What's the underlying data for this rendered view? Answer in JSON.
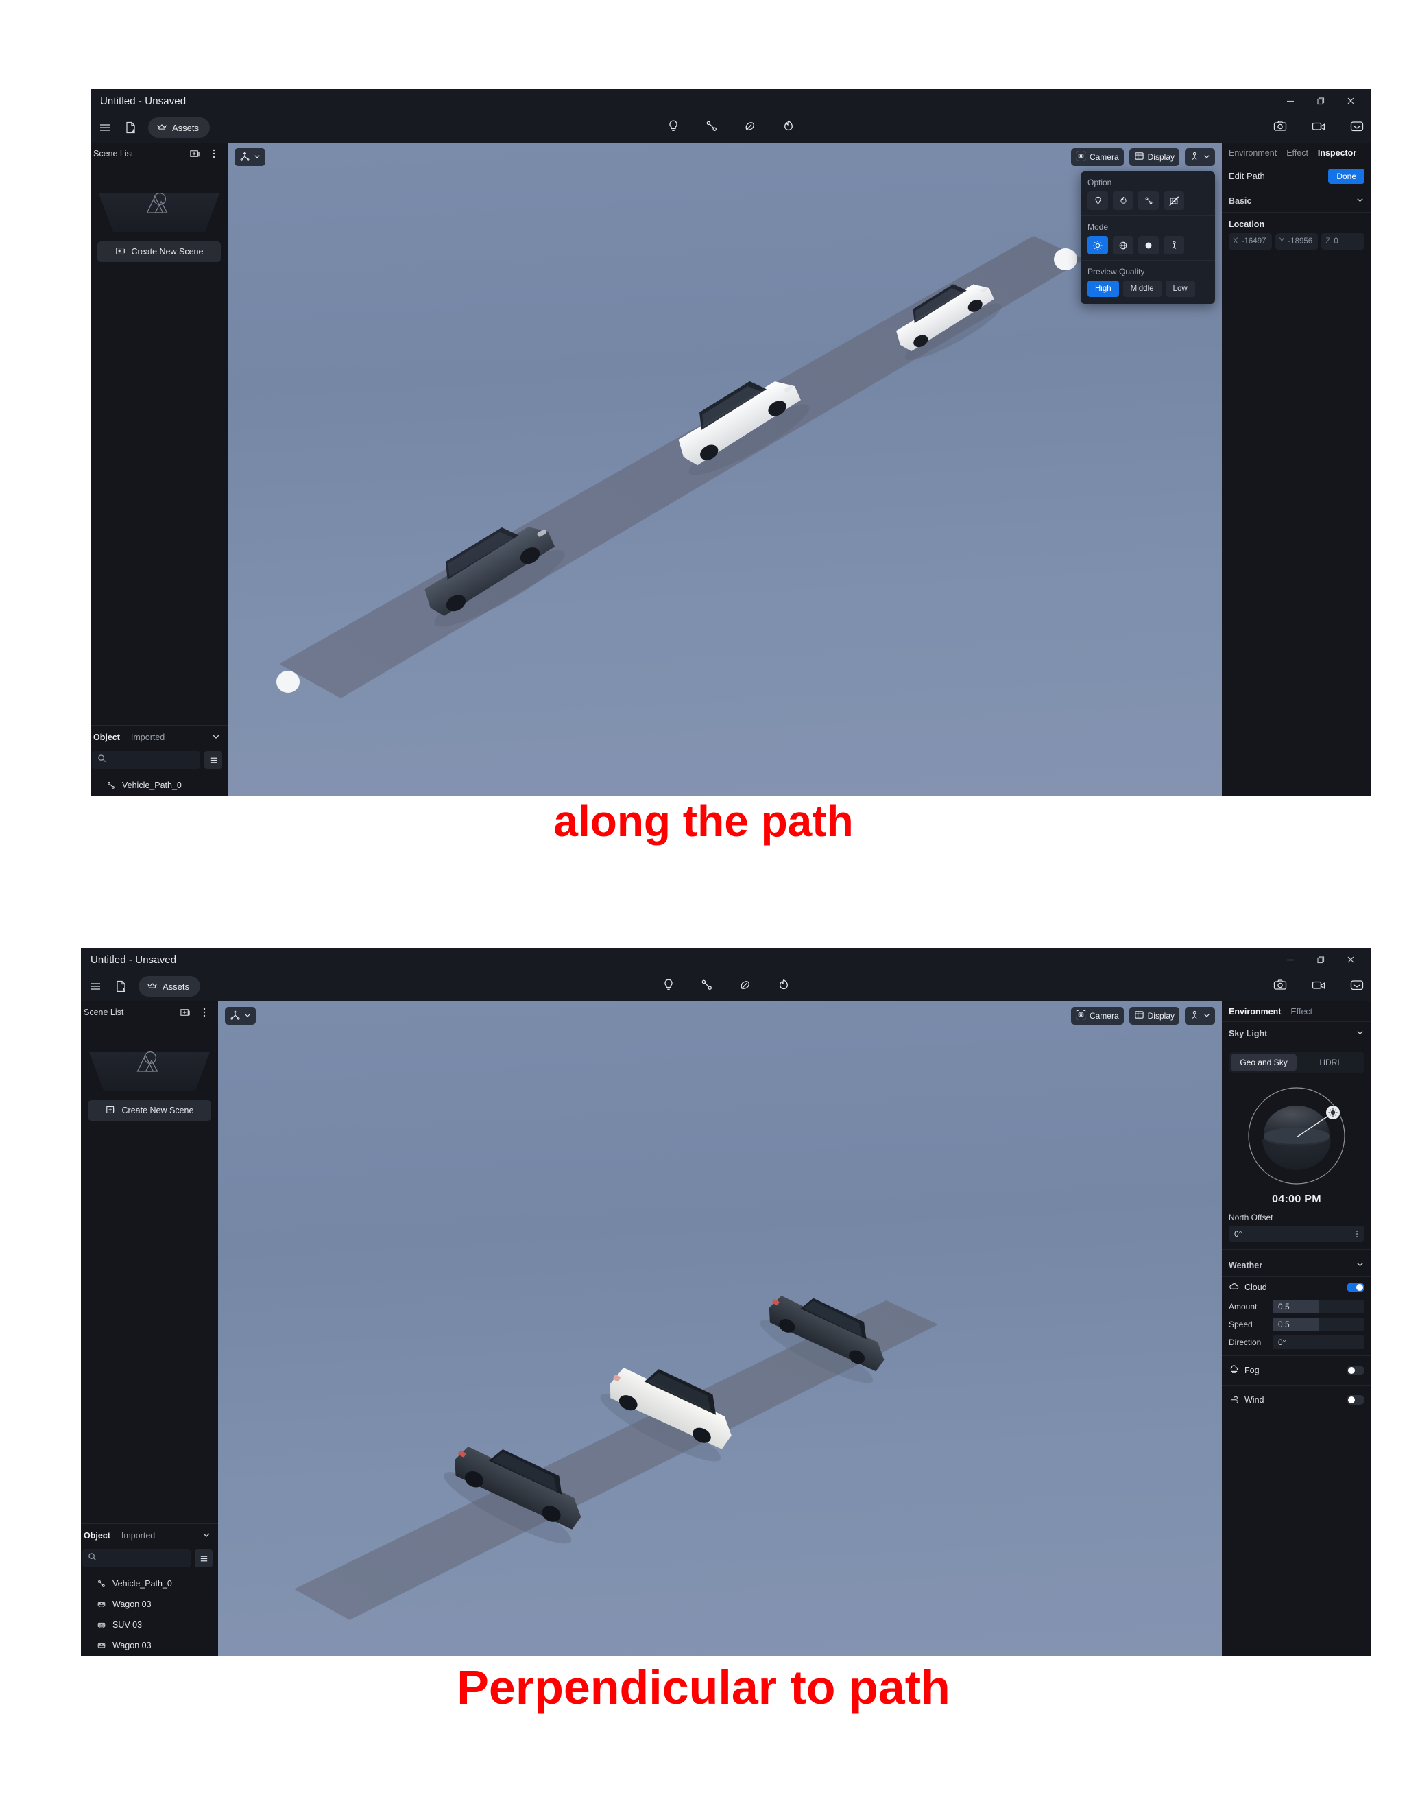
{
  "captions": {
    "top": "along the path",
    "bottom": "Perpendicular to path",
    "color": "#fe0000"
  },
  "window": {
    "title": "Untitled - Unsaved",
    "controls": {
      "minimize": "minimize-icon",
      "maximize": "restore-icon",
      "close": "close-icon"
    }
  },
  "toolbar": {
    "menu_icon": "hamburger-icon",
    "import_icon": "file-import-icon",
    "assets_label": "Assets",
    "assets_icon": "assets-crown-icon",
    "center_icons": [
      "light-bulb-icon",
      "path-node-icon",
      "leaf-icon",
      "fire-icon"
    ],
    "right_icons": [
      "camera-photo-icon",
      "video-camera-icon",
      "export-inbox-icon"
    ]
  },
  "scene_panel": {
    "title": "Scene List",
    "add_icon": "add-scene-icon",
    "more_icon": "more-vertical-icon",
    "placeholder_icon": "mountain-icon",
    "create_button": "Create New Scene",
    "create_icon": "add-frame-icon"
  },
  "object_panel": {
    "tabs": [
      "Object",
      "Imported"
    ],
    "active_tab": "Object",
    "collapse_icon": "chevron-down-icon",
    "search_placeholder": "",
    "search_value": "",
    "search_icon": "search-icon",
    "list_icon": "list-lines-icon",
    "items_top": [
      {
        "label": "Vehicle_Path_0",
        "icon": "path-node-icon"
      }
    ],
    "items_bottom": [
      {
        "label": "Vehicle_Path_0",
        "icon": "path-node-icon"
      },
      {
        "label": "Wagon 03",
        "icon": "car-icon"
      },
      {
        "label": "SUV 03",
        "icon": "car-icon"
      },
      {
        "label": "Wagon 03",
        "icon": "car-icon"
      }
    ]
  },
  "viewport": {
    "gizmo_label": "",
    "gizmo_icon": "axis-gizmo-icon",
    "chevron_icon": "chevron-down-icon",
    "camera_button": "Camera",
    "camera_icon": "camera-frame-icon",
    "display_button": "Display",
    "display_icon": "cube-display-icon",
    "lighting_icon": "lighting-gizmo-icon",
    "sky_color_top": "#7b8cab",
    "sky_color_bottom": "#8493b0",
    "road_color": "#6e768c"
  },
  "option_popup": {
    "option_label": "Option",
    "option_icons": [
      "light-bulb-icon",
      "fire-icon",
      "path-node-icon",
      "grid-icon"
    ],
    "option_active_index": -1,
    "mode_label": "Mode",
    "mode_icons": [
      "sun-icon",
      "globe-wire-icon",
      "sphere-solid-icon",
      "person-icon"
    ],
    "mode_active_index": 0,
    "preview_quality_label": "Preview Quality",
    "quality_options": [
      "High",
      "Middle",
      "Low"
    ],
    "quality_active": "High"
  },
  "inspector": {
    "tabs": [
      "Environment",
      "Effect",
      "Inspector"
    ],
    "active_tab": "Inspector",
    "panel_title": "Edit Path",
    "done_button": "Done",
    "basic_section": "Basic",
    "location_label": "Location",
    "location": {
      "x_axis": "X",
      "x": "-16497",
      "y_axis": "Y",
      "y": "-18956",
      "z_axis": "Z",
      "z": "0"
    }
  },
  "environment": {
    "tabs": [
      "Environment",
      "Effect"
    ],
    "active_tab": "Environment",
    "sky_light_label": "Sky Light",
    "seg_tabs": [
      "Geo and Sky",
      "HDRI"
    ],
    "seg_active": "Geo and Sky",
    "time": "04:00 PM",
    "sun_icon": "sun-handle-icon",
    "north_offset_label": "North Offset",
    "north_offset_value": "0°",
    "weather_label": "Weather",
    "cloud": {
      "label": "Cloud",
      "icon": "cloud-icon",
      "enabled": true,
      "fields": [
        {
          "key": "Amount",
          "value": "0.5",
          "fill_pct": 50
        },
        {
          "key": "Speed",
          "value": "0.5",
          "fill_pct": 50
        },
        {
          "key": "Direction",
          "value": "0°",
          "fill_pct": 0
        }
      ]
    },
    "fog": {
      "label": "Fog",
      "icon": "fog-icon",
      "enabled": false
    },
    "wind": {
      "label": "Wind",
      "icon": "wind-icon",
      "enabled": false
    }
  },
  "scene3d_top": {
    "description": "Three vehicles aligned along a diagonal path ribbon with white endpoint handles",
    "vehicles": [
      {
        "name": "Wagon 03",
        "color": "#3c4450"
      },
      {
        "name": "SUV 03",
        "color": "#f2f3f4"
      },
      {
        "name": "Wagon 03",
        "color": "#eef0f2"
      }
    ]
  },
  "scene3d_bottom": {
    "description": "Three vehicles rotated perpendicular to the diagonal path ribbon",
    "vehicles": [
      {
        "name": "Wagon 03",
        "color": "#2d333c"
      },
      {
        "name": "SUV 03",
        "color": "#eceae4"
      },
      {
        "name": "Wagon 03",
        "color": "#32383f"
      }
    ]
  }
}
